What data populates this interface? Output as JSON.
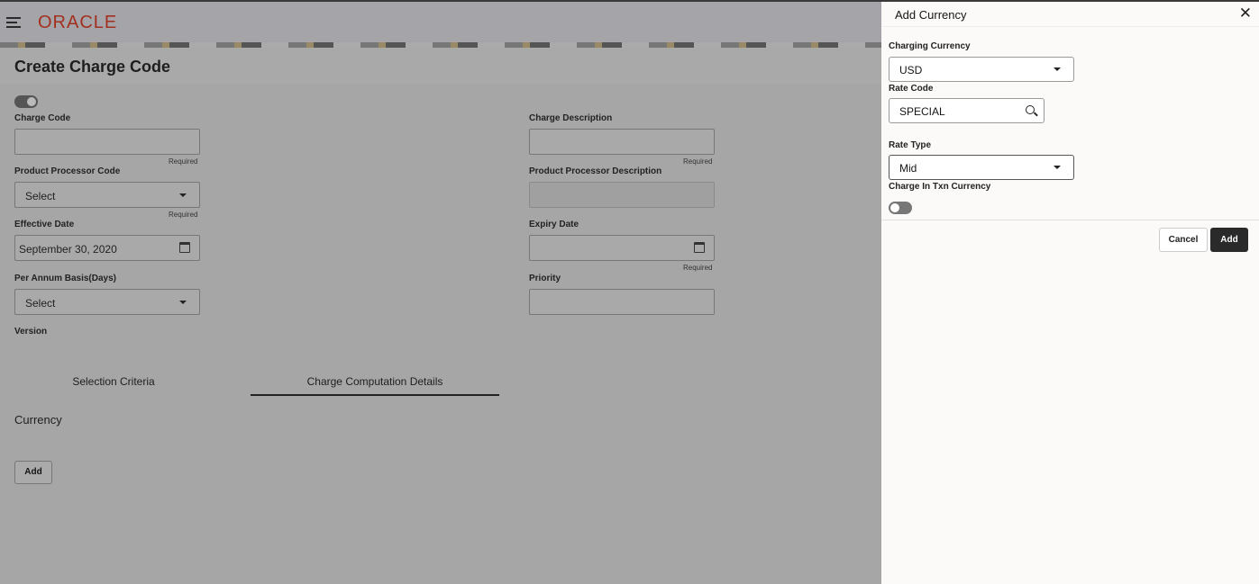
{
  "header": {
    "brand": "ORACLE"
  },
  "page": {
    "title": "Create Charge Code"
  },
  "form": {
    "charge_code": {
      "label": "Charge Code",
      "value": "",
      "hint": "Required"
    },
    "charge_description": {
      "label": "Charge Description",
      "value": "",
      "hint": "Required"
    },
    "product_processor_code": {
      "label": "Product Processor Code",
      "value": "Select",
      "hint": "Required"
    },
    "product_processor_description": {
      "label": "Product Processor Description",
      "value": ""
    },
    "effective_date": {
      "label": "Effective Date",
      "value": "September 30, 2020"
    },
    "expiry_date": {
      "label": "Expiry Date",
      "value": "",
      "hint": "Required"
    },
    "per_annum_basis": {
      "label": "Per Annum Basis(Days)",
      "value": "Select"
    },
    "priority": {
      "label": "Priority",
      "value": ""
    },
    "version": {
      "label": "Version"
    }
  },
  "tabs": [
    {
      "label": "Selection Criteria",
      "active": false
    },
    {
      "label": "Charge Computation Details",
      "active": true
    }
  ],
  "currency_section": {
    "title": "Currency",
    "add_label": "Add"
  },
  "panel": {
    "title": "Add Currency",
    "charging_currency": {
      "label": "Charging Currency",
      "value": "USD"
    },
    "rate_code": {
      "label": "Rate Code",
      "value": "SPECIAL"
    },
    "rate_type": {
      "label": "Rate Type",
      "value": "Mid"
    },
    "charge_in_txn_currency": {
      "label": "Charge In Txn Currency",
      "on": false
    },
    "cancel_label": "Cancel",
    "add_label": "Add"
  },
  "colors": {
    "brand": "#c74634",
    "primary_button": "#2a2a2a"
  }
}
